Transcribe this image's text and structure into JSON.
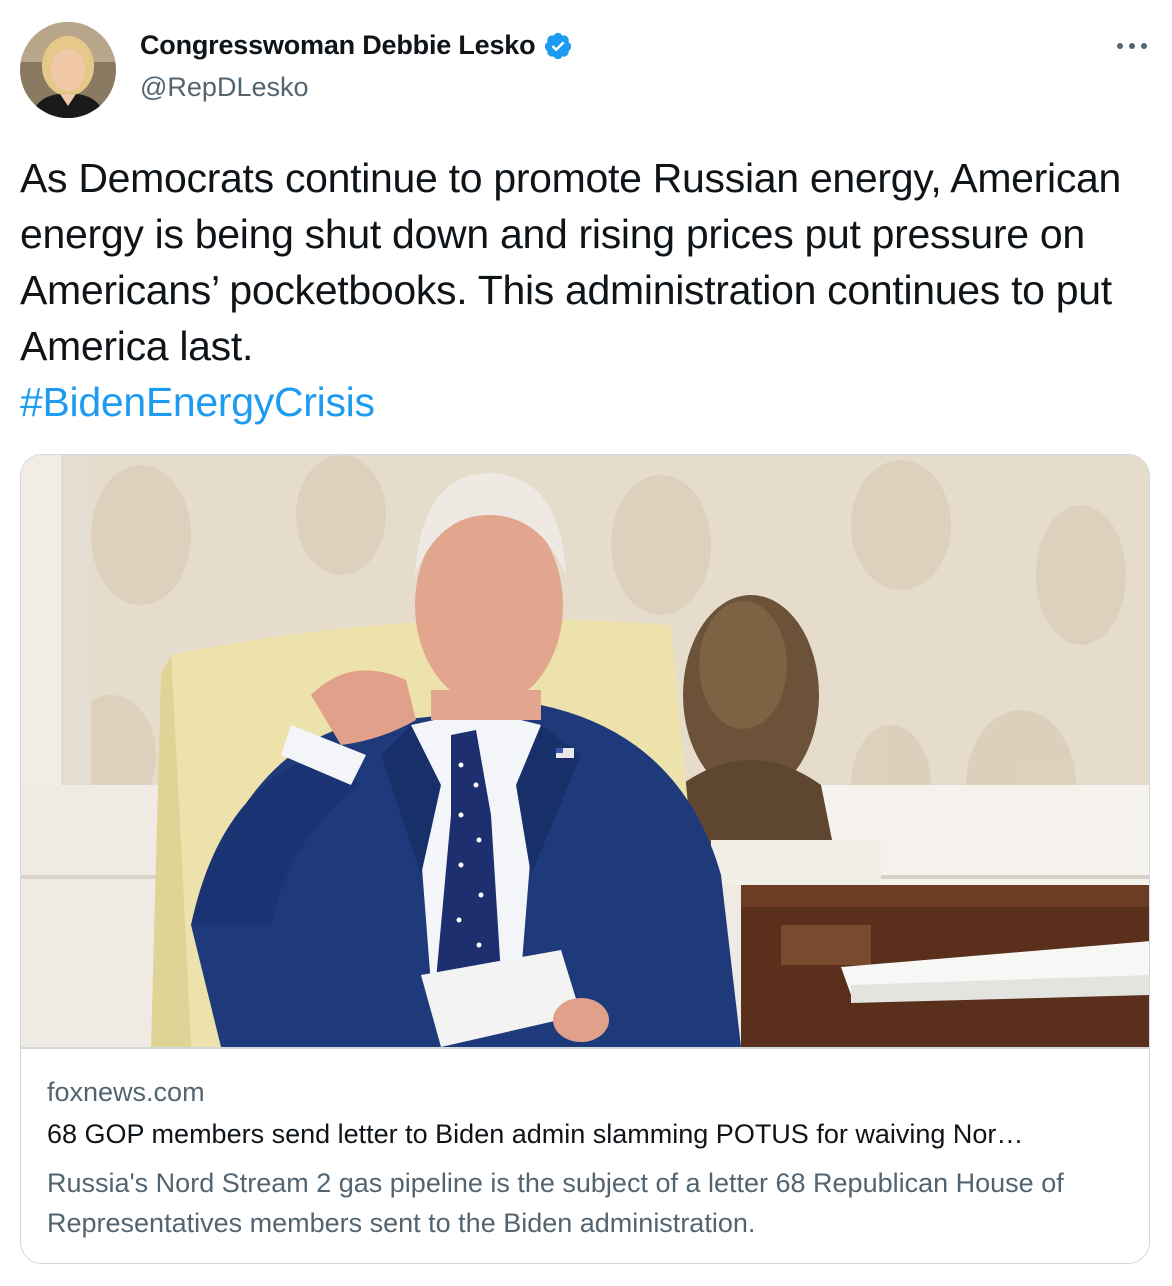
{
  "author": {
    "display_name": "Congresswoman Debbie Lesko",
    "handle": "@RepDLesko",
    "verified": true,
    "avatar_icon": "avatar-photo"
  },
  "tweet": {
    "text": "As Democrats continue to promote Russian energy, American energy is being shut down and rising prices put pressure on Americans’ pocketbooks. This administration continues to put America last.",
    "hashtag": "#BidenEnergyCrisis"
  },
  "card": {
    "image_icon": "news-photo",
    "domain": "foxnews.com",
    "title": "68 GOP members send letter to Biden admin slamming POTUS for waiving Nor…",
    "description": "Russia's Nord Stream 2 gas pipeline is the subject of a letter 68 Republican House of Representatives members sent to the Biden administration."
  },
  "colors": {
    "accent": "#1d9bf0",
    "secondary_text": "#536471",
    "border": "#cfd9de"
  }
}
